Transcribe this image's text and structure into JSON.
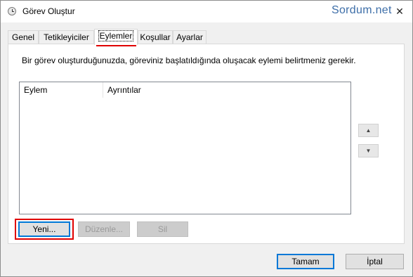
{
  "window": {
    "title": "Görev Oluştur",
    "watermark": "Sordum.net",
    "close_label": "✕"
  },
  "tabs": [
    {
      "label": "Genel",
      "active": false
    },
    {
      "label": "Tetikleyiciler",
      "active": false
    },
    {
      "label": "Eylemler",
      "active": true
    },
    {
      "label": "Koşullar",
      "active": false
    },
    {
      "label": "Ayarlar",
      "active": false
    }
  ],
  "actions_tab": {
    "description": "Bir görev oluşturduğunuzda, göreviniz başlatıldığında oluşacak eylemi belirtmeniz gerekir.",
    "columns": [
      "Eylem",
      "Ayrıntılar"
    ],
    "rows": [],
    "move_up_label": "▲",
    "move_down_label": "▼",
    "new_button": "Yeni...",
    "edit_button": "Düzenle...",
    "delete_button": "Sil"
  },
  "footer": {
    "ok_button": "Tamam",
    "cancel_button": "İptal"
  },
  "colors": {
    "highlight": "#e00000",
    "watermark": "#3d6ea8",
    "focus_border": "#0078d7"
  }
}
